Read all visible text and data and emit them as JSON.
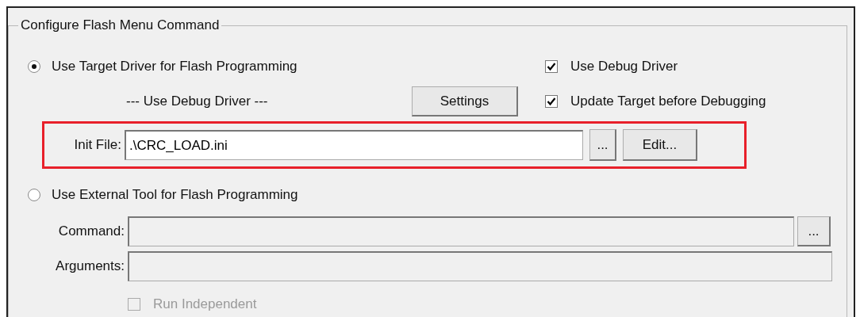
{
  "group": {
    "title": "Configure Flash Menu Command"
  },
  "target_driver": {
    "label": "Use Target Driver for Flash Programming",
    "selected": true,
    "driver_name": "--- Use Debug Driver ---",
    "settings_button": "Settings",
    "highlighted": true,
    "init_file": {
      "label": "Init File:",
      "value": ".\\CRC_LOAD.ini"
    },
    "browse_button": "...",
    "edit_button": "Edit..."
  },
  "options": [
    {
      "label": "Use Debug Driver",
      "checked": true
    },
    {
      "label": "Update Target before Debugging",
      "checked": true
    }
  ],
  "external_tool": {
    "label": "Use External Tool for Flash Programming",
    "selected": false,
    "disabled": true,
    "command": {
      "label": "Command:"
    },
    "browse_button": "...",
    "arguments": {
      "label": "Arguments:"
    },
    "run_independent": {
      "label": "Run Independent",
      "checked": false
    }
  }
}
